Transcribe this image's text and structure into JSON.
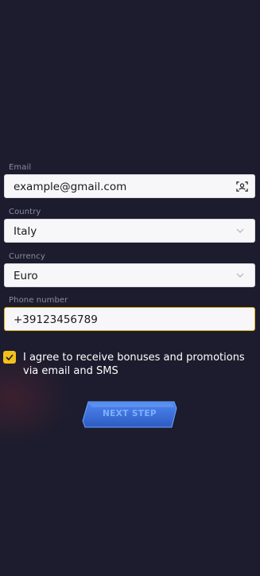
{
  "form": {
    "email": {
      "label": "Email",
      "value": "example@gmail.com"
    },
    "country": {
      "label": "Country",
      "value": "Italy"
    },
    "currency": {
      "label": "Currency",
      "value": "Euro"
    },
    "phone": {
      "label": "Phone number",
      "value": "+39123456789"
    },
    "agree": {
      "checked": true,
      "text": "I agree to receive bonuses and promotions via email and SMS"
    },
    "submit_label": "NEXT STEP"
  },
  "colors": {
    "background": "#1c1c2e",
    "accent": "#f2c01c",
    "button": "#3a6fd8"
  },
  "icons": {
    "email_field": "contact-card-icon",
    "dropdown": "chevron-down-icon",
    "checkbox": "checkmark-icon"
  }
}
